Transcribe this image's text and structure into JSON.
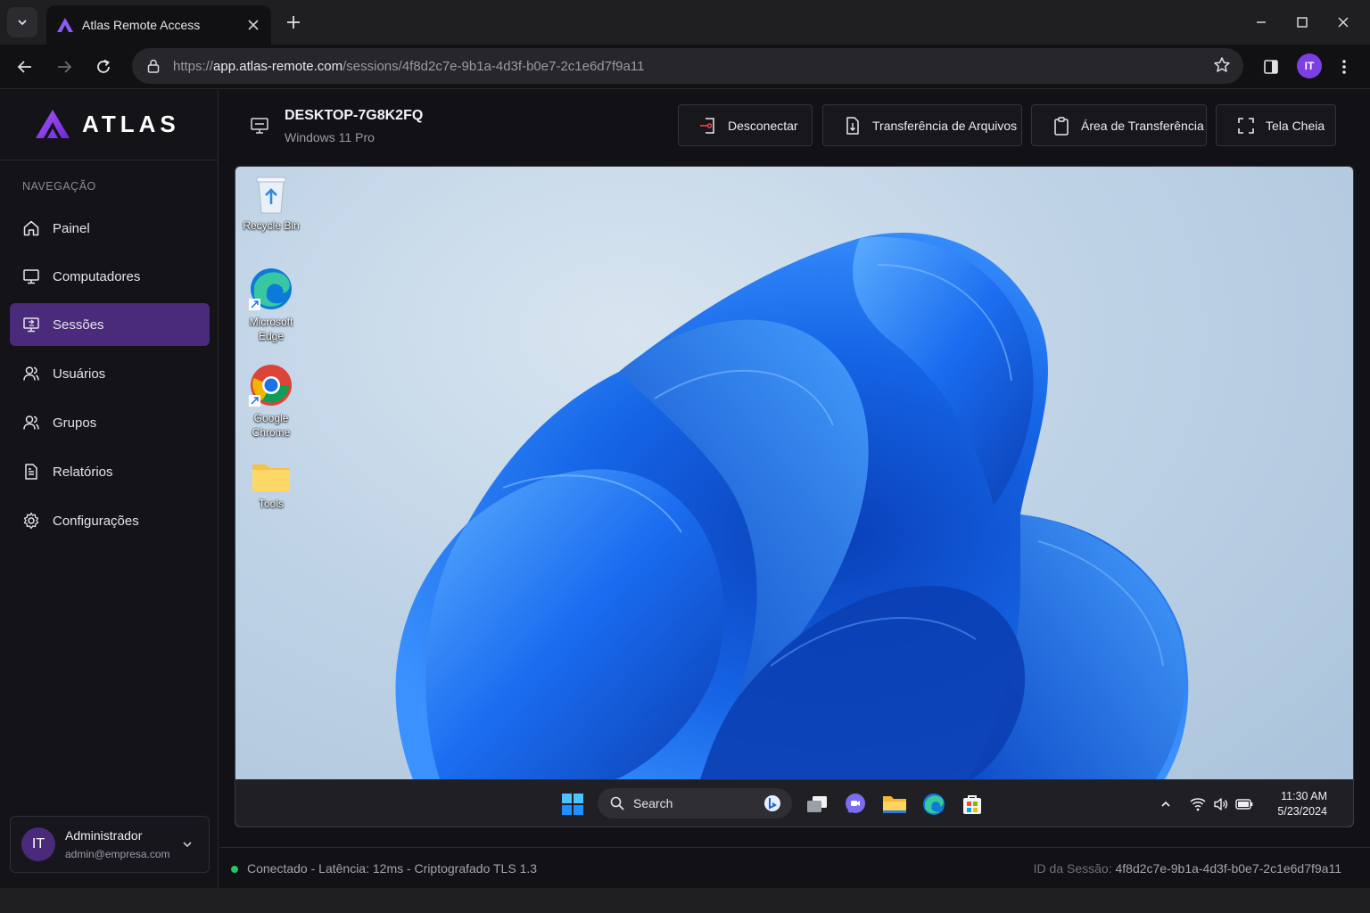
{
  "browser": {
    "tab_title": "Atlas Remote Access",
    "url_scheme": "https://",
    "url_host": "app.atlas-remote.com",
    "url_path": "/sessions/4f8d2c7e-9b1a-4d3f-b0e7-2c1e6d7f9a11",
    "profile_initials": "IT"
  },
  "sidebar": {
    "logo_text": "ATLAS",
    "nav_heading": "NAVEGAÇÃO",
    "items": [
      {
        "label": "Painel",
        "icon": "home-icon"
      },
      {
        "label": "Computadores",
        "icon": "monitor-icon"
      },
      {
        "label": "Sessões",
        "icon": "remote-session-icon",
        "active": true
      },
      {
        "label": "Usuários",
        "icon": "user-icon"
      },
      {
        "label": "Grupos",
        "icon": "users-icon"
      },
      {
        "label": "Relatórios",
        "icon": "report-icon"
      },
      {
        "label": "Configurações",
        "icon": "gear-icon"
      }
    ],
    "user": {
      "initials": "IT",
      "name": "Administrador",
      "email": "admin@empresa.com"
    }
  },
  "device": {
    "name": "DESKTOP-7G8K2FQ",
    "os": "Windows 11 Pro"
  },
  "actions": {
    "disconnect": "Desconectar",
    "file_transfer": "Transferência de Arquivos",
    "clipboard": "Área de Transferência",
    "fullscreen": "Tela Cheia"
  },
  "remote_desktop": {
    "icons": [
      {
        "label": "Recycle Bin"
      },
      {
        "label": "Microsoft Edge"
      },
      {
        "label": "Google Chrome"
      },
      {
        "label": "Tools"
      }
    ],
    "taskbar": {
      "search_placeholder": "Search",
      "time": "11:30 AM",
      "date": "5/23/2024"
    }
  },
  "status": {
    "text": "Conectado - Latência: 12ms - Criptografado TLS 1.3",
    "session_label": "ID da Sessão:",
    "session_id": "4f8d2c7e-9b1a-4d3f-b0e7-2c1e6d7f9a11"
  },
  "colors": {
    "accent": "#7b3fe4",
    "active_nav": "#4a2a7a",
    "connected": "#22c55e"
  }
}
